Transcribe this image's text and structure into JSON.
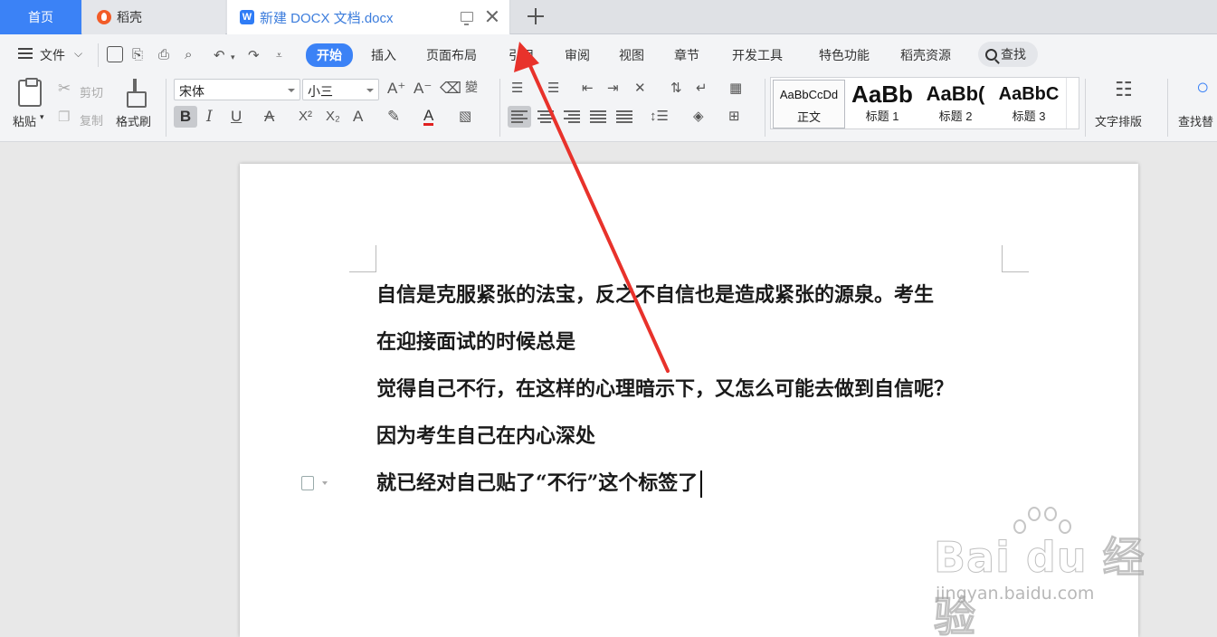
{
  "tabs": {
    "home": "首页",
    "daoke": "稻壳",
    "document": "新建 DOCX 文档.docx",
    "doc_icon_letter": "W"
  },
  "menu": {
    "file": "文件",
    "items": [
      "开始",
      "插入",
      "页面布局",
      "引用",
      "审阅",
      "视图",
      "章节",
      "开发工具",
      "特色功能",
      "稻壳资源"
    ],
    "search": "查找",
    "active_color": "#3b82f6"
  },
  "ribbon": {
    "paste": "粘贴",
    "cut": "剪切",
    "copy": "复制",
    "format_painter": "格式刷",
    "font_name": "宋体",
    "font_size": "小三",
    "styles": [
      {
        "sample": "AaBbCcDd",
        "name": "正文"
      },
      {
        "sample": "AaBb",
        "name": "标题 1"
      },
      {
        "sample": "AaBb(",
        "name": "标题 2"
      },
      {
        "sample": "AaBbC",
        "name": "标题 3"
      }
    ],
    "text_layout": "文字排版",
    "find_replace": "查找替"
  },
  "document": {
    "lines": [
      "自信是克服紧张的法宝，反之不自信也是造成紧张的源泉。考生",
      "在迎接面试的时候总是",
      "觉得自己不行，在这样的心理暗示下，又怎么可能去做到自信呢？",
      "因为考生自己在内心深处",
      "就已经对自己贴了“不行”这个标签了"
    ]
  },
  "watermark": {
    "brand": "Bai du 经验",
    "url": "jingyan.baidu.com"
  },
  "annotation_color": "#e8322b"
}
